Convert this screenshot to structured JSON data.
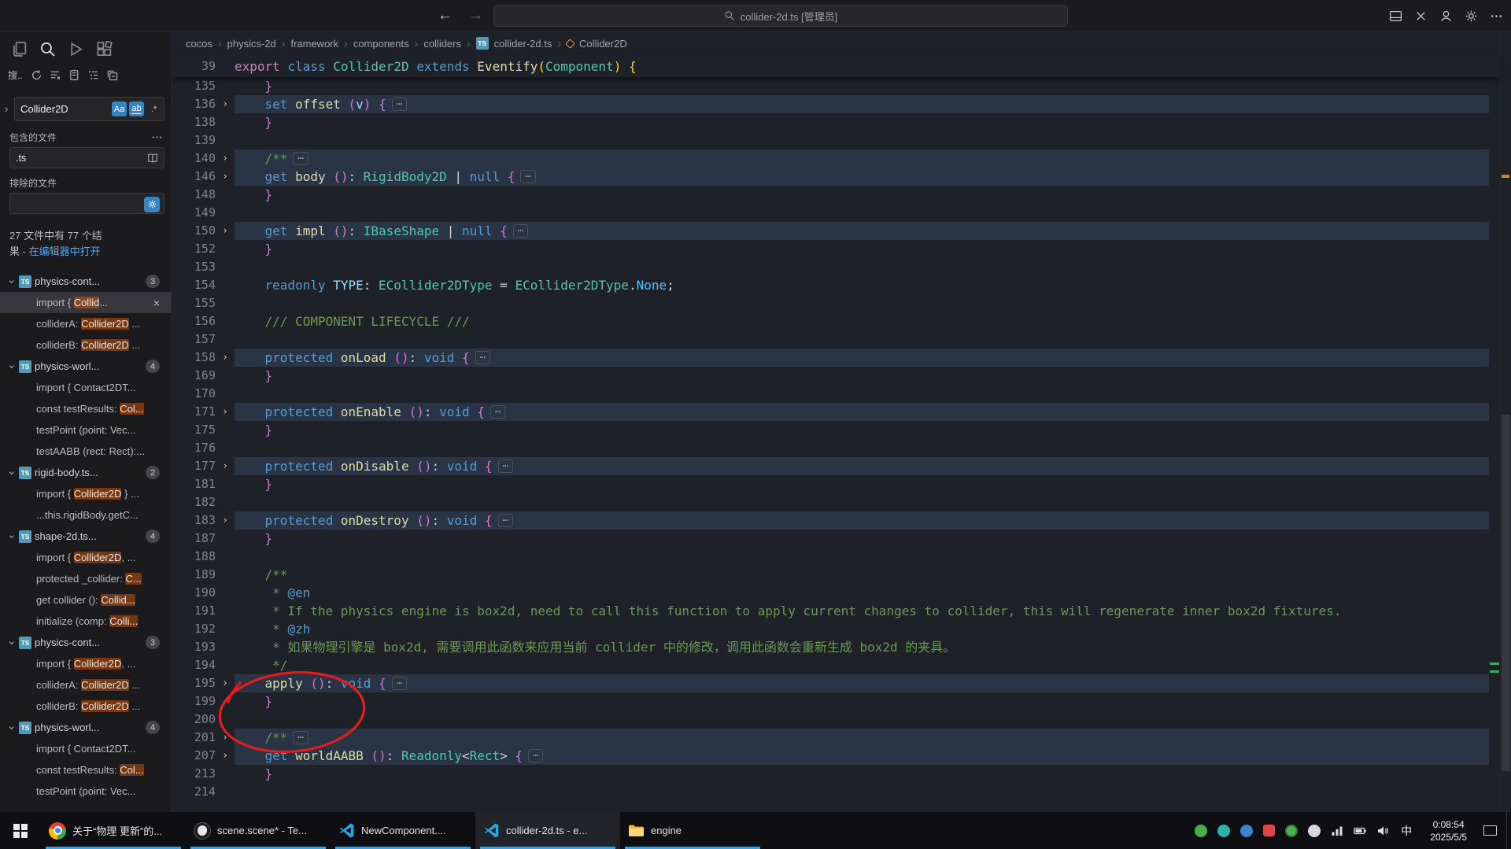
{
  "titlebar": {
    "search_text": "collider-2d.ts [管理员]"
  },
  "icons": {
    "command_center": "search-icon",
    "activity": [
      "files-icon",
      "search-icon",
      "run-debug-icon",
      "extensions-icon"
    ],
    "view_actions": [
      "refresh-icon",
      "clear-results-icon",
      "new-search-editor-icon",
      "view-as-tree-icon",
      "collapse-all-icon"
    ]
  },
  "colors": {
    "accent_blue": "#3584c4",
    "match_highlight_orange": "#ea5c00",
    "fold_highlight_blue": "#6096d6",
    "annotation_red": "#e11d1d",
    "ts_icon_blue": "#519aba",
    "running_indicator": "#3aa0dc"
  },
  "sidebar": {
    "view_title": "搜..",
    "search_query": "Collider2D",
    "toggles": {
      "match_case": "Aa",
      "whole_word": "ab",
      "regex": ".*"
    },
    "include_label": "包含的文件",
    "include_value": ".ts",
    "exclude_label": "排除的文件",
    "exclude_value": "",
    "summary_line1": "27 文件中有 77 个结",
    "summary_line2_prefix": "果 - ",
    "summary_link": "在编辑器中打开",
    "groups": [
      {
        "name": "physics-cont...",
        "count": "3",
        "items": [
          {
            "pre": "import { ",
            "match": "Collid",
            "post": "...",
            "selected": true,
            "closable": true
          },
          {
            "pre": "colliderA: ",
            "match": "Collider2D",
            "post": " ..."
          },
          {
            "pre": "colliderB: ",
            "match": "Collider2D",
            "post": " ..."
          }
        ]
      },
      {
        "name": "physics-worl...",
        "count": "4",
        "items": [
          {
            "pre": "import { Contact2DT..."
          },
          {
            "pre": "const testResults: ",
            "match": "Col..."
          },
          {
            "pre": "testPoint (point: Vec..."
          },
          {
            "pre": "testAABB (rect: Rect):..."
          }
        ]
      },
      {
        "name": "rigid-body.ts...",
        "count": "2",
        "items": [
          {
            "pre": "import { ",
            "match": "Collider2D",
            "post": " } ..."
          },
          {
            "pre": "...this.rigidBody.getC..."
          }
        ]
      },
      {
        "name": "shape-2d.ts...",
        "count": "4",
        "items": [
          {
            "pre": "import { ",
            "match": "Collider2D",
            "post": ", ..."
          },
          {
            "pre": "protected _collider: ",
            "match": "C..."
          },
          {
            "pre": "get collider (): ",
            "match": "Collid..."
          },
          {
            "pre": "initialize (comp: ",
            "match": "Colli..."
          }
        ]
      },
      {
        "name": "physics-cont...",
        "count": "3",
        "items": [
          {
            "pre": "import { ",
            "match": "Collider2D",
            "post": ", ..."
          },
          {
            "pre": "colliderA: ",
            "match": "Collider2D",
            "post": " ..."
          },
          {
            "pre": "colliderB: ",
            "match": "Collider2D",
            "post": " ..."
          }
        ]
      },
      {
        "name": "physics-worl...",
        "count": "4",
        "items": [
          {
            "pre": "import { Contact2DT..."
          },
          {
            "pre": "const testResults: ",
            "match": "Col..."
          },
          {
            "pre": "testPoint (point: Vec..."
          }
        ]
      }
    ]
  },
  "breadcrumb": {
    "items": [
      "cocos",
      "physics-2d",
      "framework",
      "components",
      "colliders",
      "collider-2d.ts",
      "Collider2D"
    ]
  },
  "editor": {
    "sticky": {
      "number": "39",
      "tokens": [
        [
          "export",
          "m"
        ],
        [
          " ",
          "p"
        ],
        [
          "class",
          "k"
        ],
        [
          " ",
          "p"
        ],
        [
          "Collider2D",
          "t"
        ],
        [
          " ",
          "p"
        ],
        [
          "extends",
          "k"
        ],
        [
          " ",
          "p"
        ],
        [
          "Eventify",
          "f"
        ],
        [
          "(",
          "g"
        ],
        [
          "Component",
          "t"
        ],
        [
          ")",
          "g"
        ],
        [
          " ",
          "p"
        ],
        [
          "{",
          "g"
        ]
      ]
    },
    "lines": [
      {
        "n": "135",
        "k": [
          [
            "    }",
            "b"
          ]
        ]
      },
      {
        "n": "136",
        "f": true,
        "k": [
          [
            "    ",
            "p"
          ],
          [
            "set",
            "k"
          ],
          [
            " ",
            "p"
          ],
          [
            "offset",
            "f"
          ],
          [
            " ",
            "p"
          ],
          [
            "(",
            "b"
          ],
          [
            "v",
            "v"
          ],
          [
            ")",
            "b"
          ],
          [
            " ",
            "p"
          ],
          [
            "{",
            "b"
          ]
        ]
      },
      {
        "n": "138",
        "k": [
          [
            "    }",
            "b"
          ]
        ]
      },
      {
        "n": "139",
        "k": []
      },
      {
        "n": "140",
        "f": true,
        "k": [
          [
            "    ",
            "p"
          ],
          [
            "/**",
            "c"
          ]
        ]
      },
      {
        "n": "146",
        "f": true,
        "k": [
          [
            "    ",
            "p"
          ],
          [
            "get",
            "k"
          ],
          [
            " ",
            "p"
          ],
          [
            "body",
            "f"
          ],
          [
            " ",
            "p"
          ],
          [
            "()",
            "b"
          ],
          [
            ": ",
            "p"
          ],
          [
            "RigidBody2D",
            "t"
          ],
          [
            " | ",
            "p"
          ],
          [
            "null",
            "k"
          ],
          [
            " ",
            "p"
          ],
          [
            "{",
            "b"
          ]
        ]
      },
      {
        "n": "148",
        "k": [
          [
            "    }",
            "b"
          ]
        ]
      },
      {
        "n": "149",
        "k": []
      },
      {
        "n": "150",
        "f": true,
        "k": [
          [
            "    ",
            "p"
          ],
          [
            "get",
            "k"
          ],
          [
            " ",
            "p"
          ],
          [
            "impl",
            "f"
          ],
          [
            " ",
            "p"
          ],
          [
            "()",
            "b"
          ],
          [
            ": ",
            "p"
          ],
          [
            "IBaseShape",
            "t"
          ],
          [
            " | ",
            "p"
          ],
          [
            "null",
            "k"
          ],
          [
            " ",
            "p"
          ],
          [
            "{",
            "b"
          ]
        ]
      },
      {
        "n": "152",
        "k": [
          [
            "    }",
            "b"
          ]
        ]
      },
      {
        "n": "153",
        "k": []
      },
      {
        "n": "154",
        "k": [
          [
            "    ",
            "p"
          ],
          [
            "readonly",
            "k"
          ],
          [
            " ",
            "p"
          ],
          [
            "TYPE",
            "v"
          ],
          [
            ": ",
            "p"
          ],
          [
            "ECollider2DType",
            "t"
          ],
          [
            " = ",
            "p"
          ],
          [
            "ECollider2DType",
            "t"
          ],
          [
            ".",
            "p"
          ],
          [
            "None",
            "e"
          ],
          [
            ";",
            "p"
          ]
        ]
      },
      {
        "n": "155",
        "k": []
      },
      {
        "n": "156",
        "k": [
          [
            "    ",
            "p"
          ],
          [
            "/// COMPONENT LIFECYCLE ///",
            "c"
          ]
        ]
      },
      {
        "n": "157",
        "k": []
      },
      {
        "n": "158",
        "f": true,
        "k": [
          [
            "    ",
            "p"
          ],
          [
            "protected",
            "k"
          ],
          [
            " ",
            "p"
          ],
          [
            "onLoad",
            "f"
          ],
          [
            " ",
            "p"
          ],
          [
            "()",
            "b"
          ],
          [
            ": ",
            "p"
          ],
          [
            "void",
            "k"
          ],
          [
            " ",
            "p"
          ],
          [
            "{",
            "b"
          ]
        ]
      },
      {
        "n": "169",
        "k": [
          [
            "    }",
            "b"
          ]
        ]
      },
      {
        "n": "170",
        "k": []
      },
      {
        "n": "171",
        "f": true,
        "k": [
          [
            "    ",
            "p"
          ],
          [
            "protected",
            "k"
          ],
          [
            " ",
            "p"
          ],
          [
            "onEnable",
            "f"
          ],
          [
            " ",
            "p"
          ],
          [
            "()",
            "b"
          ],
          [
            ": ",
            "p"
          ],
          [
            "void",
            "k"
          ],
          [
            " ",
            "p"
          ],
          [
            "{",
            "b"
          ]
        ]
      },
      {
        "n": "175",
        "k": [
          [
            "    }",
            "b"
          ]
        ]
      },
      {
        "n": "176",
        "k": []
      },
      {
        "n": "177",
        "f": true,
        "k": [
          [
            "    ",
            "p"
          ],
          [
            "protected",
            "k"
          ],
          [
            " ",
            "p"
          ],
          [
            "onDisable",
            "f"
          ],
          [
            " ",
            "p"
          ],
          [
            "()",
            "b"
          ],
          [
            ": ",
            "p"
          ],
          [
            "void",
            "k"
          ],
          [
            " ",
            "p"
          ],
          [
            "{",
            "b"
          ]
        ]
      },
      {
        "n": "181",
        "k": [
          [
            "    }",
            "b"
          ]
        ]
      },
      {
        "n": "182",
        "k": []
      },
      {
        "n": "183",
        "f": true,
        "k": [
          [
            "    ",
            "p"
          ],
          [
            "protected",
            "k"
          ],
          [
            " ",
            "p"
          ],
          [
            "onDestroy",
            "f"
          ],
          [
            " ",
            "p"
          ],
          [
            "()",
            "b"
          ],
          [
            ": ",
            "p"
          ],
          [
            "void",
            "k"
          ],
          [
            " ",
            "p"
          ],
          [
            "{",
            "b"
          ]
        ]
      },
      {
        "n": "187",
        "k": [
          [
            "    }",
            "b"
          ]
        ]
      },
      {
        "n": "188",
        "k": []
      },
      {
        "n": "189",
        "k": [
          [
            "    ",
            "p"
          ],
          [
            "/**",
            "c"
          ]
        ]
      },
      {
        "n": "190",
        "k": [
          [
            "     ",
            "p"
          ],
          [
            "* ",
            "c"
          ],
          [
            "@en",
            "d"
          ]
        ]
      },
      {
        "n": "191",
        "k": [
          [
            "     ",
            "p"
          ],
          [
            "* If the physics engine is box2d, need to call this function to apply current changes to collider, this will regenerate inner box2d fixtures.",
            "c"
          ]
        ]
      },
      {
        "n": "192",
        "k": [
          [
            "     ",
            "p"
          ],
          [
            "* ",
            "c"
          ],
          [
            "@zh",
            "d"
          ]
        ]
      },
      {
        "n": "193",
        "k": [
          [
            "     ",
            "p"
          ],
          [
            "* 如果物理引擎是 box2d, 需要调用此函数来应用当前 collider 中的修改，调用此函数会重新生成 box2d 的夹具。",
            "c"
          ]
        ]
      },
      {
        "n": "194",
        "k": [
          [
            "     ",
            "p"
          ],
          [
            "*/",
            "c"
          ]
        ]
      },
      {
        "n": "195",
        "f": true,
        "k": [
          [
            "    ",
            "p"
          ],
          [
            "apply",
            "f"
          ],
          [
            " ",
            "p"
          ],
          [
            "()",
            "b"
          ],
          [
            ": ",
            "p"
          ],
          [
            "void",
            "k"
          ],
          [
            " ",
            "p"
          ],
          [
            "{",
            "b"
          ]
        ]
      },
      {
        "n": "199",
        "k": [
          [
            "    }",
            "b"
          ]
        ]
      },
      {
        "n": "200",
        "k": []
      },
      {
        "n": "201",
        "f": true,
        "k": [
          [
            "    ",
            "p"
          ],
          [
            "/**",
            "c"
          ]
        ]
      },
      {
        "n": "207",
        "f": true,
        "k": [
          [
            "    ",
            "p"
          ],
          [
            "get",
            "k"
          ],
          [
            " ",
            "p"
          ],
          [
            "worldAABB",
            "f"
          ],
          [
            " ",
            "p"
          ],
          [
            "()",
            "b"
          ],
          [
            ": ",
            "p"
          ],
          [
            "Readonly",
            "t"
          ],
          [
            "<",
            "p"
          ],
          [
            "Rect",
            "t"
          ],
          [
            ">",
            "p"
          ],
          [
            " ",
            "p"
          ],
          [
            "{",
            "b"
          ]
        ]
      },
      {
        "n": "213",
        "k": [
          [
            "    }",
            "b"
          ]
        ]
      },
      {
        "n": "214",
        "k": []
      }
    ]
  },
  "taskbar": {
    "buttons": [
      {
        "label": "关于“物理 更新”的..."
      },
      {
        "label": "scene.scene* - Te..."
      },
      {
        "label": "NewComponent...."
      },
      {
        "label": "collider-2d.ts - e..."
      },
      {
        "label": "engine"
      }
    ],
    "ime": "中",
    "time": "0:08:54",
    "date": "2025/5/5"
  }
}
